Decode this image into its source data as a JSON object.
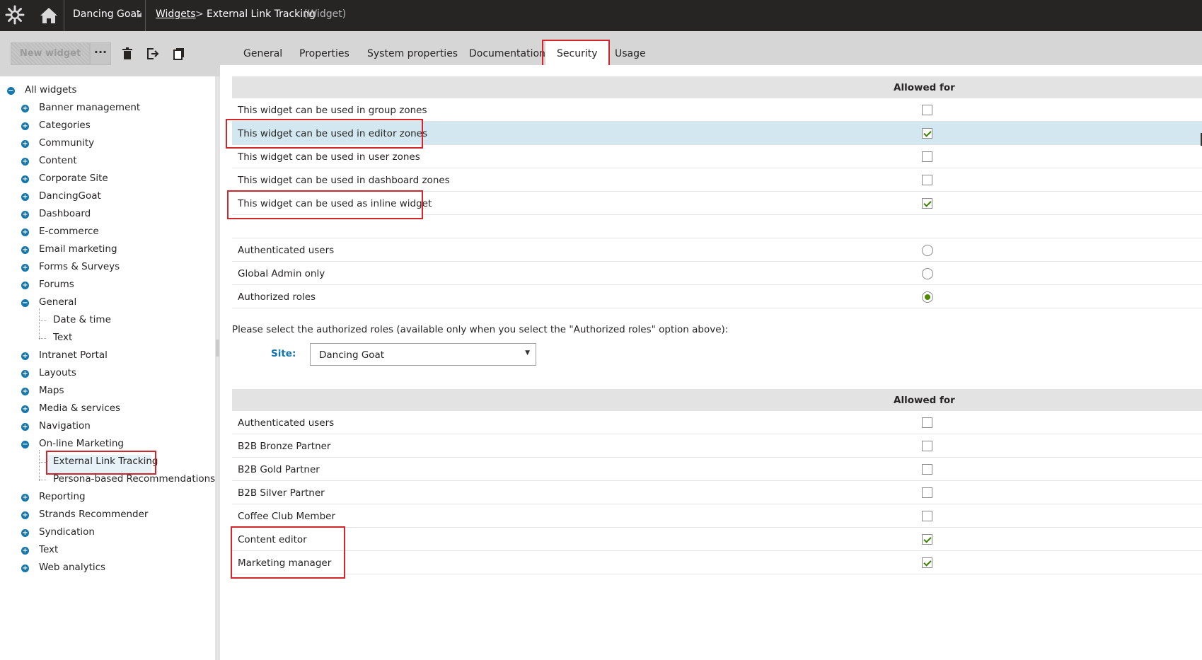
{
  "topbar": {
    "site_name": "Dancing Goat",
    "breadcrumb_link": "Widgets",
    "breadcrumb_separator": ">",
    "breadcrumb_current": "External Link Tracking",
    "breadcrumb_type": "(Widget)",
    "icons": [
      "kentico-logo-icon",
      "home-icon",
      "caret-down-icon"
    ]
  },
  "toolbar": {
    "new_widget_label": "New widget",
    "more_label": "···",
    "icons": [
      "trash-icon",
      "export-icon",
      "clone-icon"
    ]
  },
  "tabs": [
    {
      "label": "General"
    },
    {
      "label": "Properties"
    },
    {
      "label": "System properties"
    },
    {
      "label": "Documentation"
    },
    {
      "label": "Security",
      "active": true
    },
    {
      "label": "Usage"
    }
  ],
  "tree": {
    "root": "All widgets",
    "items": [
      "Banner management",
      "Categories",
      "Community",
      "Content",
      "Corporate Site",
      "DancingGoat",
      "Dashboard",
      "E-commerce",
      "Email marketing",
      "Forms & Surveys",
      "Forums",
      "General",
      "Date & time",
      "Text",
      "Intranet Portal",
      "Layouts",
      "Maps",
      "Media & services",
      "Navigation",
      "On-line Marketing",
      "External Link Tracking",
      "Persona-based Recommendations",
      "Reporting",
      "Strands Recommender",
      "Syndication",
      "Text",
      "Web analytics"
    ],
    "selected": "External Link Tracking"
  },
  "zones": {
    "header": "Allowed for",
    "rows": [
      {
        "label": "This widget can be used in group zones",
        "checked": false
      },
      {
        "label": "This widget can be used in editor zones",
        "checked": true
      },
      {
        "label": "This widget can be used in user zones",
        "checked": false
      },
      {
        "label": "This widget can be used in dashboard zones",
        "checked": false
      },
      {
        "label": "This widget can be used as inline widget",
        "checked": true
      }
    ]
  },
  "access": {
    "rows": [
      {
        "label": "Authenticated users",
        "selected": false
      },
      {
        "label": "Global Admin only",
        "selected": false
      },
      {
        "label": "Authorized roles",
        "selected": true
      }
    ]
  },
  "roles_instruction": "Please select the authorized roles (available only when you select the \"Authorized roles\" option above):",
  "site_selector": {
    "label": "Site:",
    "value": "Dancing Goat"
  },
  "roles": {
    "header": "Allowed for",
    "rows": [
      {
        "label": "Authenticated users",
        "checked": false
      },
      {
        "label": "B2B Bronze Partner",
        "checked": false
      },
      {
        "label": "B2B Gold Partner",
        "checked": false
      },
      {
        "label": "B2B Silver Partner",
        "checked": false
      },
      {
        "label": "Coffee Club Member",
        "checked": false
      },
      {
        "label": "Content editor",
        "checked": true
      },
      {
        "label": "Marketing manager",
        "checked": true
      }
    ]
  },
  "colors": {
    "topbar": "#262524",
    "accent_blue": "#1175ae",
    "highlight_red": "#d0262c",
    "row_highlight": "#d2e7f0",
    "check_green": "#3d7f00"
  }
}
